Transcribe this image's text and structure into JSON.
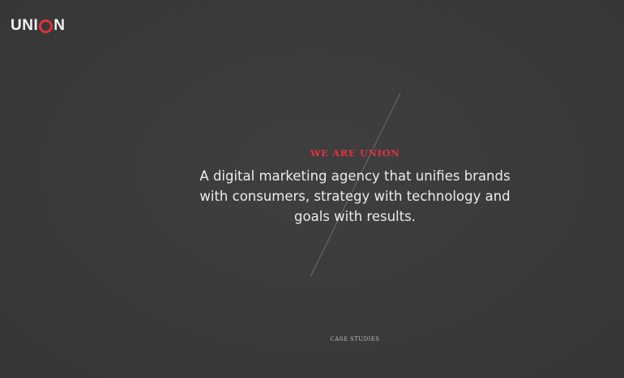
{
  "brand": {
    "logo_prefix": "UNI",
    "logo_suffix": "N",
    "accent_color": "#e0323c"
  },
  "hero": {
    "eyebrow": "WE ARE UNION",
    "headline": "A digital marketing agency that unifies brands with consumers, strategy with technology and goals with results."
  },
  "nav": {
    "case_studies_label": "CASE STUDIES"
  },
  "colors": {
    "background": "#3a3a3a",
    "text": "#ececec"
  }
}
